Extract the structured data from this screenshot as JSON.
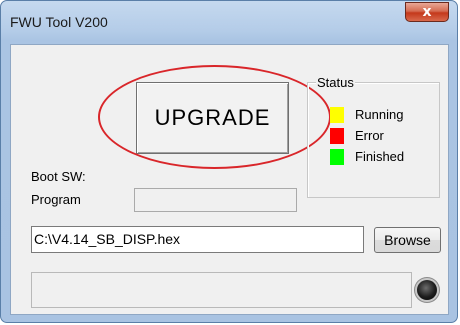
{
  "window": {
    "title": "FWU Tool V200",
    "close_label": "x"
  },
  "upgrade_button": {
    "label": "UPGRADE"
  },
  "status": {
    "title": "Status",
    "items": [
      {
        "label": "Running",
        "color": "#ffff00"
      },
      {
        "label": "Error",
        "color": "#ff0000"
      },
      {
        "label": "Finished",
        "color": "#00ff00"
      }
    ]
  },
  "labels": {
    "boot_sw": "Boot SW:",
    "program": "Program"
  },
  "file": {
    "path": "C:\\V4.14_SB_DISP.hex",
    "browse_label": "Browse"
  },
  "colors": {
    "highlight_circle": "#d9262a",
    "titlebar": "#b4cce8"
  }
}
